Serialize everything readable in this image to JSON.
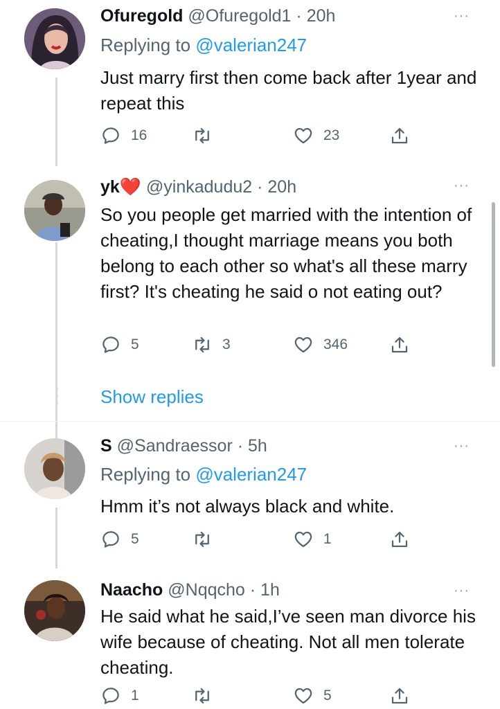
{
  "tweets": [
    {
      "display_name": "Ofuregold",
      "handle": "@Ofuregold1",
      "time": "· 20h",
      "replying_prefix": "Replying to ",
      "replying_to": "@valerian247",
      "text": "Just marry first then come back after 1year and repeat this",
      "replies": "16",
      "retweets": "",
      "likes": "23"
    },
    {
      "display_name": "yk",
      "name_emoji": "❤️",
      "handle": "@yinkadudu2",
      "time": "· 20h",
      "text": "So you people get married with the intention of cheating,I thought marriage means you both belong to each other so what's all these marry first? It's cheating he said o not eating out?",
      "replies": "5",
      "retweets": "3",
      "likes": "346"
    },
    {
      "display_name": "S",
      "handle": "@Sandraessor",
      "time": "· 5h",
      "replying_prefix": "Replying to ",
      "replying_to": "@valerian247",
      "text": "Hmm it’s not always black and white.",
      "replies": "5",
      "retweets": "",
      "likes": "1"
    },
    {
      "display_name": "Naacho",
      "handle": "@Nqqcho",
      "time": "· 1h",
      "text": "He said what he said,I’ve seen man divorce his wife because of cheating. Not all men tolerate cheating.",
      "replies": "1",
      "retweets": "",
      "likes": "5"
    }
  ],
  "thread": {
    "show_replies": "Show replies"
  },
  "more_icon": "···",
  "icons": {
    "reply": "reply-icon",
    "retweet": "retweet-icon",
    "like": "heart-icon",
    "share": "share-icon",
    "more": "more-icon"
  },
  "colors": {
    "link": "#1d9bf0",
    "muted": "#536471",
    "text": "#0f1419",
    "line": "#cfd9de"
  }
}
